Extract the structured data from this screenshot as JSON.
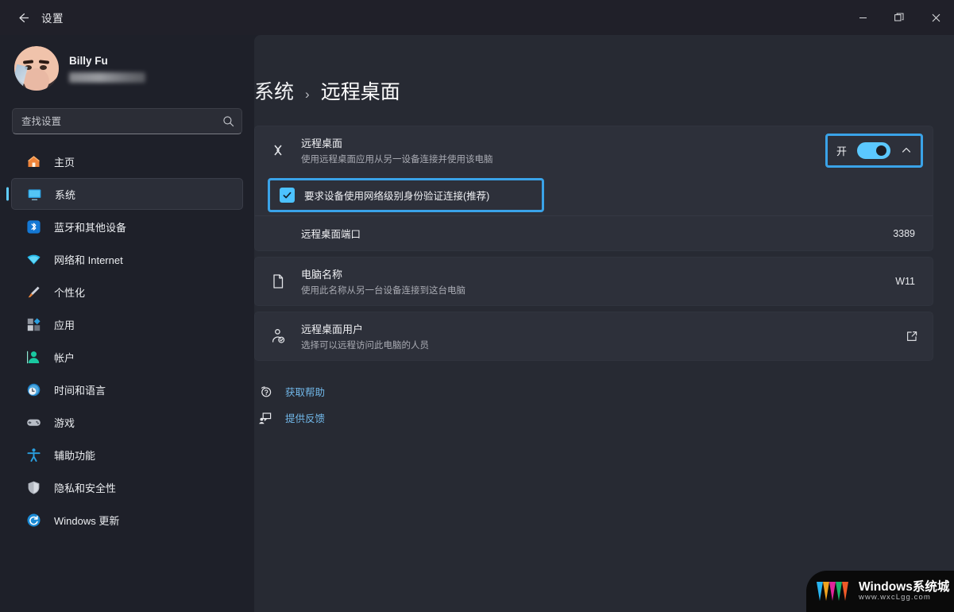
{
  "window": {
    "title": "设置",
    "back_label": "返回",
    "controls": {
      "minimize": "最小化",
      "restore": "还原",
      "close": "关闭"
    }
  },
  "account": {
    "name": "Billy Fu",
    "email_masked": ""
  },
  "search": {
    "placeholder": "查找设置",
    "value": "",
    "icon": "search-icon"
  },
  "sidebar": {
    "items": [
      {
        "label": "主页",
        "icon": "home-icon",
        "selected": false
      },
      {
        "label": "系统",
        "icon": "system-monitor-icon",
        "selected": true
      },
      {
        "label": "蓝牙和其他设备",
        "icon": "bluetooth-icon",
        "selected": false
      },
      {
        "label": "网络和 Internet",
        "icon": "network-wifi-icon",
        "selected": false
      },
      {
        "label": "个性化",
        "icon": "personalization-brush-icon",
        "selected": false
      },
      {
        "label": "应用",
        "icon": "apps-icon",
        "selected": false
      },
      {
        "label": "帐户",
        "icon": "accounts-person-icon",
        "selected": false
      },
      {
        "label": "时间和语言",
        "icon": "time-language-clock-icon",
        "selected": false
      },
      {
        "label": "游戏",
        "icon": "gaming-controller-icon",
        "selected": false
      },
      {
        "label": "辅助功能",
        "icon": "accessibility-icon",
        "selected": false
      },
      {
        "label": "隐私和安全性",
        "icon": "privacy-shield-icon",
        "selected": false
      },
      {
        "label": "Windows 更新",
        "icon": "windows-update-icon",
        "selected": false
      }
    ]
  },
  "breadcrumb": {
    "parent": "系统",
    "separator": "›",
    "current": "远程桌面"
  },
  "remote_desktop": {
    "title": "远程桌面",
    "subtitle": "使用远程桌面应用从另一设备连接并使用该电脑",
    "icon": "remote-desktop-icon",
    "toggle_label": "开",
    "toggle_state": "on",
    "expand_icon": "chevron-up-icon",
    "highlight_color": "#3aa3e8"
  },
  "nla": {
    "label": "要求设备使用网络级别身份验证连接(推荐)",
    "checked": true,
    "checkbox_color": "#4cc2ff",
    "highlight_color": "#3aa3e8"
  },
  "port": {
    "label": "远程桌面端口",
    "value": "3389"
  },
  "pc_name": {
    "title": "电脑名称",
    "subtitle": "使用此名称从另一台设备连接到这台电脑",
    "value": "W11",
    "icon": "pc-name-icon"
  },
  "rd_users": {
    "title": "远程桌面用户",
    "subtitle": "选择可以远程访问此电脑的人员",
    "icon": "remote-desktop-users-icon",
    "action_icon": "external-link-icon"
  },
  "links": [
    {
      "label": "获取帮助",
      "icon": "get-help-icon"
    },
    {
      "label": "提供反馈",
      "icon": "give-feedback-icon"
    }
  ],
  "watermark": {
    "title": "Windows系统城",
    "url": "www.wxcLgg.com",
    "logo": "w-logo-icon"
  },
  "colors": {
    "accent": "#60cdff",
    "highlight": "#3aa3e8",
    "link": "#71b7e8",
    "content_bg": "#272a33",
    "card_bg": "#2d303a",
    "sidebar_bg": "#1e2029"
  }
}
